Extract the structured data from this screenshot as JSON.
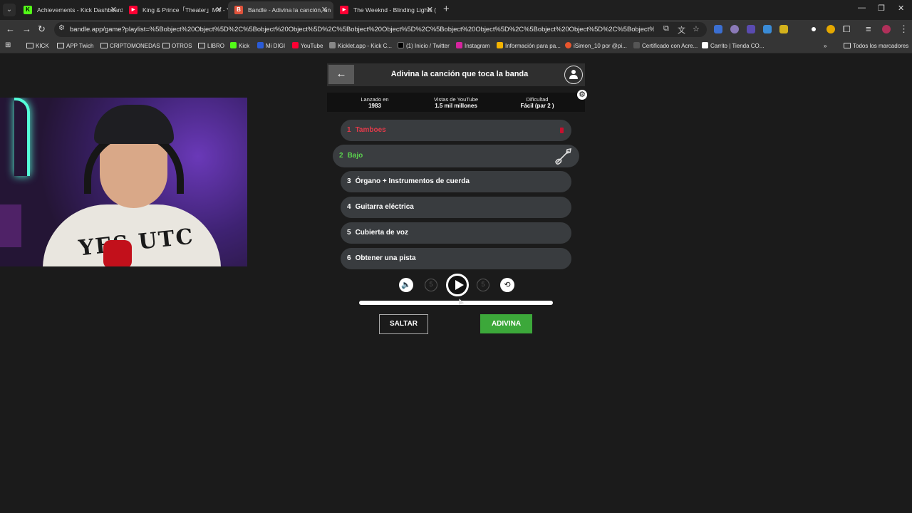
{
  "browser": {
    "tabs": [
      {
        "title": "Achievements - Kick Dashboard",
        "icon": "kick-icon",
        "color": "#53fc18"
      },
      {
        "title": "King & Prince「Theater」MV - Yo",
        "icon": "youtube-icon",
        "color": "#ff0033"
      },
      {
        "title": "Bandle - Adivina la canción, un",
        "icon": "bandle-icon",
        "color": "#e0523b",
        "active": true
      },
      {
        "title": "The Weeknd - Blinding Lights (",
        "icon": "youtube-icon",
        "color": "#ff0033"
      }
    ],
    "url": "bandle.app/game?playlist=%5Bobject%20Object%5D%2C%5Bobject%20Object%5D%2C%5Bobject%20Object%5D%2C%5Bobject%20Object%5D%2C%5Bobject%20Object%5D%2C%5Bobject%20Object%5D",
    "bookmarks": [
      {
        "label": "KICK",
        "type": "folder"
      },
      {
        "label": "APP Twich",
        "type": "folder"
      },
      {
        "label": "CRIPTOMONEDAS",
        "type": "folder"
      },
      {
        "label": "OTROS",
        "type": "folder"
      },
      {
        "label": "LIBRO",
        "type": "folder"
      },
      {
        "label": "Kick",
        "type": "site",
        "color": "#53fc18"
      },
      {
        "label": "Mi DIGI",
        "type": "site",
        "color": "#2a5bd7"
      },
      {
        "label": "YouTube",
        "type": "site",
        "color": "#ff0033"
      },
      {
        "label": "Kicklet.app - Kick C...",
        "type": "site",
        "color": "#888888"
      },
      {
        "label": "(1) Inicio / Twitter",
        "type": "site",
        "color": "#000000"
      },
      {
        "label": "Instagram",
        "type": "site",
        "color": "#d6249f"
      },
      {
        "label": "Información para pa...",
        "type": "site",
        "color": "#f4b400"
      },
      {
        "label": "iSimon_10 por @pi...",
        "type": "site",
        "color": "#e8552d"
      },
      {
        "label": "Certificado con Acre...",
        "type": "site",
        "color": "#555555"
      },
      {
        "label": "Carrito | Tienda CO...",
        "type": "site",
        "color": "#ffffff"
      }
    ],
    "all_bookmarks": "Todos los marcadores"
  },
  "app": {
    "title": "Adivina la canción que toca la banda",
    "info": [
      {
        "label": "Lanzado en",
        "value": "1983"
      },
      {
        "label": "Vistas de YouTube",
        "value": "1.5 mil millones"
      },
      {
        "label": "Dificultad",
        "value": "Fácil (par 2 )"
      }
    ],
    "tracks": [
      {
        "num": "1",
        "label": "Tamboes",
        "state": "failed"
      },
      {
        "num": "2",
        "label": "Bajo",
        "state": "current"
      },
      {
        "num": "3",
        "label": "Órgano + Instrumentos de cuerda",
        "state": "locked"
      },
      {
        "num": "4",
        "label": "Guitarra eléctrica",
        "state": "locked"
      },
      {
        "num": "5",
        "label": "Cubierta de voz",
        "state": "locked"
      },
      {
        "num": "6",
        "label": "Obtener una pista",
        "state": "locked"
      }
    ],
    "controls": {
      "rewind_seconds": "5",
      "forward_seconds": "5"
    },
    "progress_fraction": 0.0,
    "skip_label": "SALTAR",
    "guess_label": "ADIVINA",
    "colors": {
      "accent": "#3ca83a",
      "failed": "#e23a4a",
      "current": "#5bd14e"
    }
  }
}
